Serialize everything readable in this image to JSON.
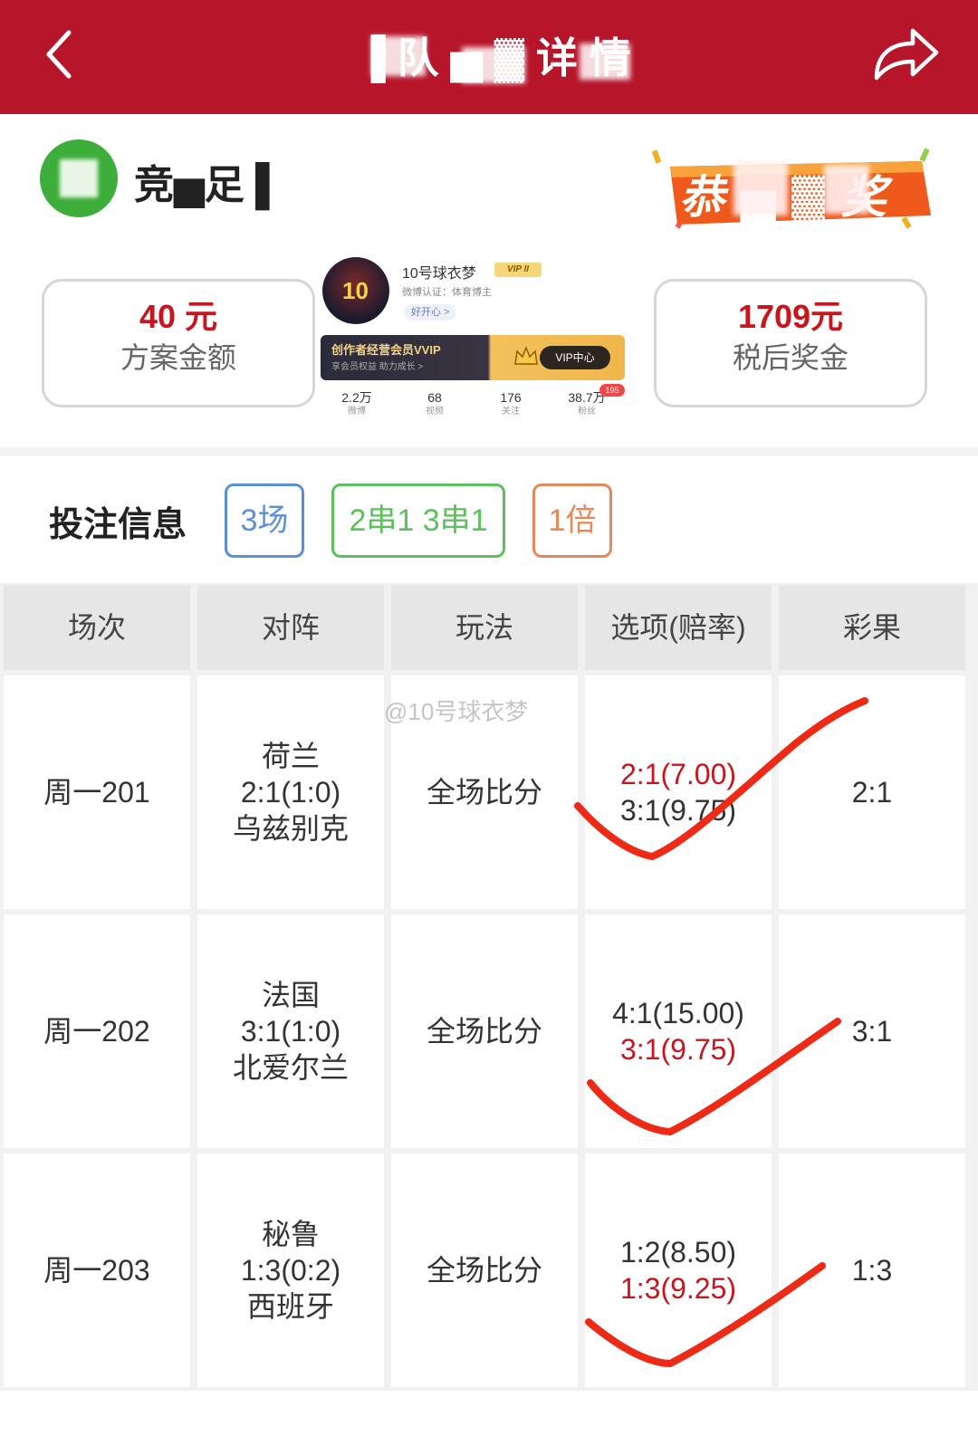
{
  "header": {
    "title": "▐ 队 ▅ ▓ 详 情",
    "bg_color": "#b7152a"
  },
  "brand": {
    "name": "竞▅足 ▌",
    "logo_color": "#3dae3a"
  },
  "prize_badge": {
    "text": "恭 ▅ ▓ 奖"
  },
  "summary": {
    "plan_amount": {
      "value": "40 元",
      "label": "方案金额"
    },
    "after_tax": {
      "value": "1709元",
      "label": "税后奖金"
    }
  },
  "profile": {
    "name": "10号球衣梦",
    "vip": "VIP II",
    "cert": "微博认证：体育博主",
    "mood": "好开心 >",
    "avatar_number": "10",
    "creator_banner": "创作者经营会员VVIP",
    "creator_sub": "享会员权益 助力成长 >",
    "vip_center": "VIP中心",
    "stats": [
      {
        "value": "2.2万",
        "label": "微博"
      },
      {
        "value": "68",
        "label": "视频"
      },
      {
        "value": "176",
        "label": "关注"
      },
      {
        "value": "38.7万",
        "label": "粉丝"
      }
    ],
    "fans_badge": "195"
  },
  "bet": {
    "title": "投注信息",
    "tags": [
      {
        "label": "3场",
        "color": "#5b8fd6"
      },
      {
        "label": "2串1 3串1",
        "color": "#5cc05c"
      },
      {
        "label": "1倍",
        "color": "#e8875a"
      }
    ]
  },
  "table": {
    "headers": [
      "场次",
      "对阵",
      "玩法",
      "选项(赔率)",
      "彩果"
    ],
    "rows": [
      {
        "match_no": "周一201",
        "home": "荷兰",
        "score": "2:1(1:0)",
        "away": "乌兹别克",
        "play": "全场比分",
        "opt1": "2:1(7.00)",
        "opt2": "3:1(9.75)",
        "result": "2:1"
      },
      {
        "match_no": "周一202",
        "home": "法国",
        "score": "3:1(1:0)",
        "away": "北爱尔兰",
        "play": "全场比分",
        "opt1": "4:1(15.00)",
        "opt2": "3:1(9.75)",
        "result": "3:1"
      },
      {
        "match_no": "周一203",
        "home": "秘鲁",
        "score": "1:3(0:2)",
        "away": "西班牙",
        "play": "全场比分",
        "opt1": "1:2(8.50)",
        "opt2": "1:3(9.25)",
        "result": "1:3"
      }
    ]
  },
  "watermark": "@10号球衣梦",
  "hit_color": "#c9161e",
  "check_color": "#ee2a16"
}
